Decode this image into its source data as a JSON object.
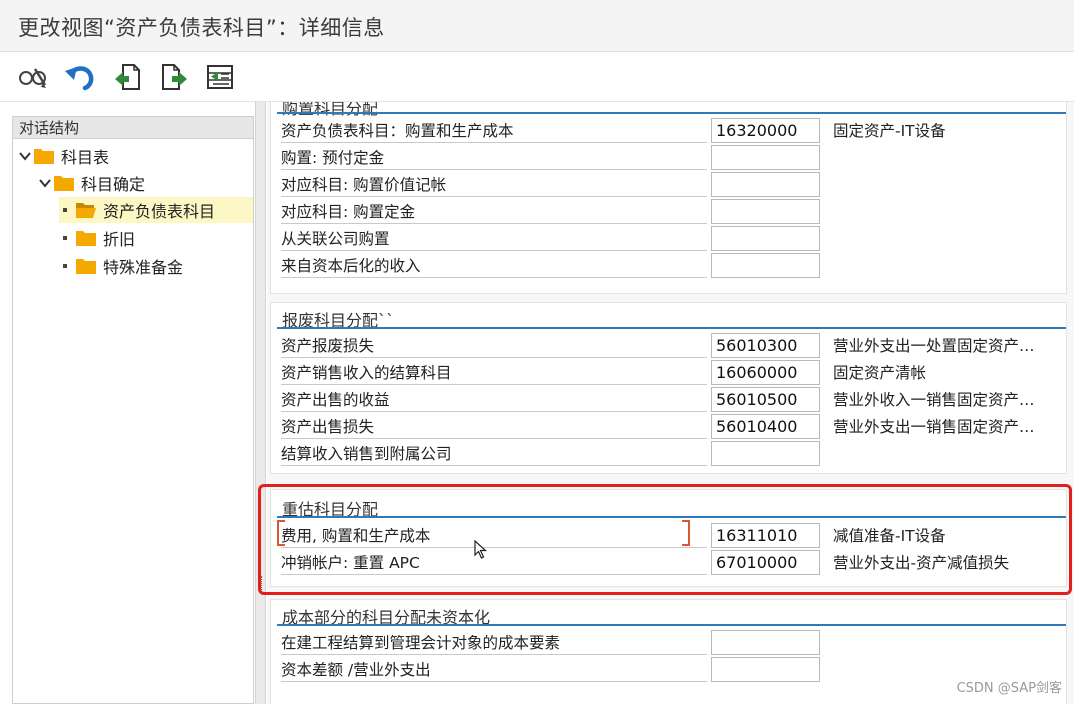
{
  "window": {
    "title": "更改视图“资产负债表科目”：详细信息"
  },
  "toolbar": {
    "buttons": [
      {
        "name": "display-change-icon"
      },
      {
        "name": "undo-icon"
      },
      {
        "name": "previous-entry-icon"
      },
      {
        "name": "next-entry-icon"
      },
      {
        "name": "select-block-icon"
      }
    ]
  },
  "dialog_structure": {
    "header": "对话结构",
    "nodes": [
      {
        "label": "科目表"
      },
      {
        "label": "科目确定"
      },
      {
        "label": "资产负债表科目",
        "selected": true
      },
      {
        "label": "折旧"
      },
      {
        "label": "特殊准备金"
      }
    ]
  },
  "groups": [
    {
      "title": "购置科目分配",
      "rows": [
        {
          "label": "资产负债表科目：购置和生产成本",
          "value": "16320000",
          "desc": "固定资产-IT设备"
        },
        {
          "label": "购置: 预付定金",
          "value": "",
          "desc": ""
        },
        {
          "label": "对应科目: 购置价值记帐",
          "value": "",
          "desc": ""
        },
        {
          "label": "对应科目: 购置定金",
          "value": "",
          "desc": ""
        },
        {
          "label": "从关联公司购置",
          "value": "",
          "desc": ""
        },
        {
          "label": "来自资本后化的收入",
          "value": "",
          "desc": ""
        }
      ]
    },
    {
      "title": "报废科目分配``",
      "rows": [
        {
          "label": "资产报废损失",
          "value": "56010300",
          "desc": "营业外支出一处置固定资产…"
        },
        {
          "label": "资产销售收入的结算科目",
          "value": "16060000",
          "desc": "固定资产清帐"
        },
        {
          "label": "资产出售的收益",
          "value": "56010500",
          "desc": "营业外收入一销售固定资产…"
        },
        {
          "label": "资产出售损失",
          "value": "56010400",
          "desc": "营业外支出一销售固定资产…"
        },
        {
          "label": "结算收入销售到附属公司",
          "value": "",
          "desc": ""
        }
      ]
    },
    {
      "title": "重估科目分配",
      "rows": [
        {
          "label": "费用, 购置和生产成本",
          "value": "16311010",
          "desc": "减值准备-IT设备"
        },
        {
          "label": "冲销帐户: 重置 APC",
          "value": "67010000",
          "desc": "营业外支出-资产减值损失"
        }
      ]
    },
    {
      "title": "成本部分的科目分配未资本化",
      "rows": [
        {
          "label": "在建工程结算到管理会计对象的成本要素",
          "value": "",
          "desc": ""
        },
        {
          "label": "资本差额 /营业外支出",
          "value": "",
          "desc": ""
        }
      ]
    }
  ],
  "watermark": "CSDN @SAP剑客",
  "colors": {
    "accent_rule": "#2e79b9",
    "highlight_box": "#e0201e",
    "folder": "#f5a800",
    "selected_row": "#fdf7c5"
  }
}
